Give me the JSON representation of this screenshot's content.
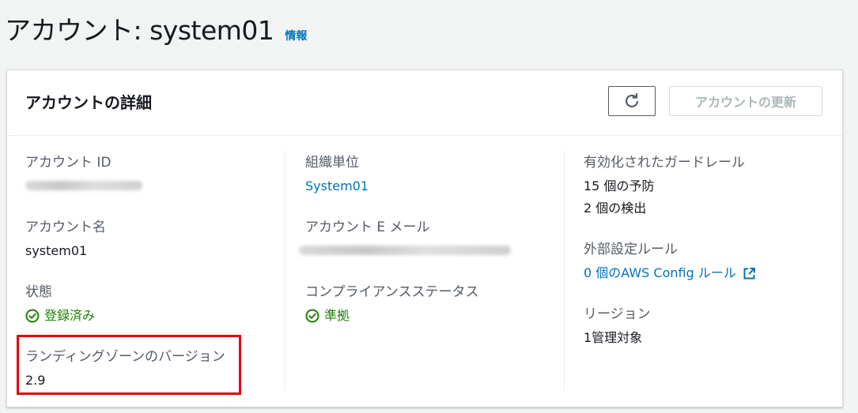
{
  "page": {
    "title": "アカウント: system01",
    "info_link": "情報"
  },
  "panel": {
    "heading": "アカウントの詳細",
    "refresh_icon": "refresh-icon",
    "update_button": "アカウントの更新"
  },
  "details": {
    "account_id": {
      "label": "アカウント ID",
      "value": ""
    },
    "account_name": {
      "label": "アカウント名",
      "value": "system01"
    },
    "state": {
      "label": "状態",
      "value": "登録済み",
      "icon": "check-circle-icon"
    },
    "landing_zone_version": {
      "label": "ランディングゾーンのバージョン",
      "value": "2.9"
    },
    "org_unit": {
      "label": "組織単位",
      "value": "System01"
    },
    "account_email": {
      "label": "アカウント E メール",
      "value": ""
    },
    "compliance_status": {
      "label": "コンプライアンスステータス",
      "value": "準拠",
      "icon": "check-circle-icon"
    },
    "guardrails": {
      "label": "有効化されたガードレール",
      "preventive": "15 個の予防",
      "detective": "2 個の検出"
    },
    "config_rules": {
      "label": "外部設定ルール",
      "value": "0 個のAWS Config ルール",
      "icon": "external-link-icon"
    },
    "region": {
      "label": "リージョン",
      "value": "1管理対象"
    }
  },
  "colors": {
    "link": "#0073bb",
    "success": "#1d8102",
    "highlight": "#e0000b"
  }
}
